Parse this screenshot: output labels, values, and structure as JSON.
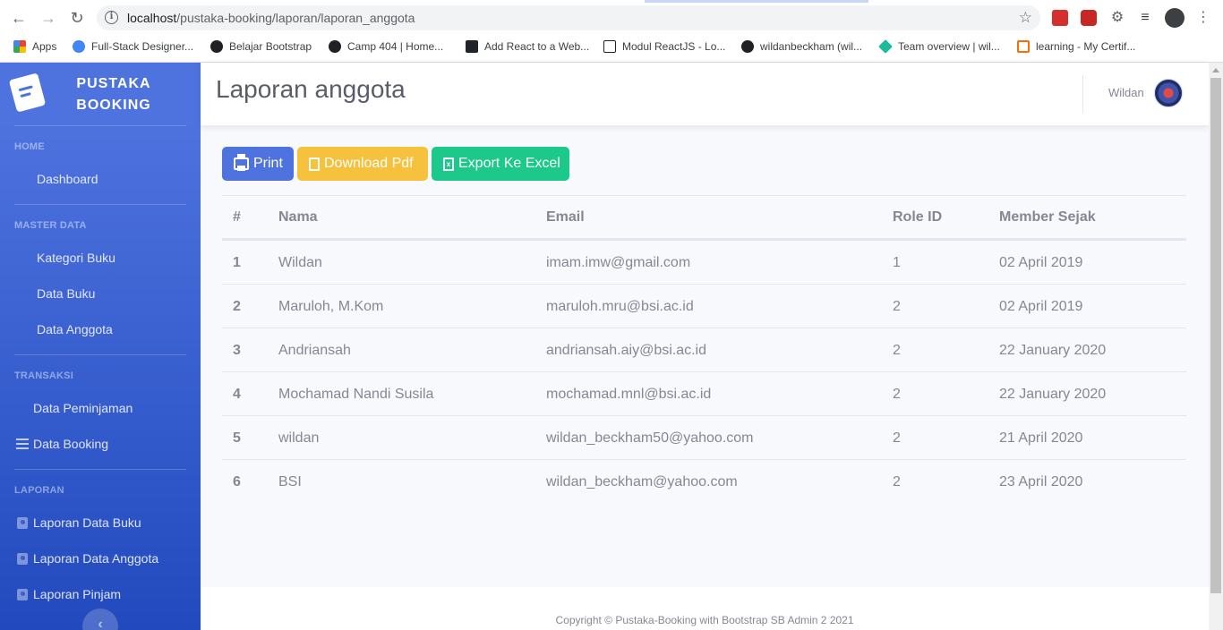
{
  "browser": {
    "url_host": "localhost",
    "url_path": "/pustaka-booking/laporan/laporan_anggota",
    "bookmarks": [
      {
        "label": "Apps",
        "color": "#ea4335"
      },
      {
        "label": "Full-Stack Designer...",
        "color": "#4285f4"
      },
      {
        "label": "Belajar Bootstrap",
        "color": "#202124"
      },
      {
        "label": "Camp 404 | Home...",
        "color": "#202124"
      },
      {
        "label": "Add React to a Web...",
        "color": "#61dafb"
      },
      {
        "label": "Modul ReactJS - Lo...",
        "color": "#202124"
      },
      {
        "label": "wildanbeckham (wil...",
        "color": "#202124"
      },
      {
        "label": "Team overview | wil...",
        "color": "#1abc9c"
      },
      {
        "label": "learning - My Certif...",
        "color": "#ff6d00"
      }
    ]
  },
  "sidebar": {
    "brand_line1": "PUSTAKA",
    "brand_line2": "BOOKING",
    "heading_home": "HOME",
    "dashboard": "Dashboard",
    "heading_master": "MASTER DATA",
    "kategori_buku": "Kategori Buku",
    "data_buku": "Data Buku",
    "data_anggota": "Data Anggota",
    "heading_transaksi": "TRANSAKSI",
    "data_peminjaman": "Data Peminjaman",
    "data_booking": "Data Booking",
    "heading_laporan": "LAPORAN",
    "laporan_buku": "Laporan Data Buku",
    "laporan_anggota": "Laporan Data Anggota",
    "laporan_pinjam": "Laporan Pinjam",
    "toggle": "‹"
  },
  "topbar": {
    "title": "Laporan anggota",
    "user_name": "Wildan"
  },
  "actions": {
    "print": "Print",
    "download_pdf": "Download Pdf",
    "export_excel": "Export Ke Excel"
  },
  "table": {
    "headers": [
      "#",
      "Nama",
      "Email",
      "Role ID",
      "Member Sejak"
    ],
    "rows": [
      [
        "1",
        "Wildan",
        "imam.imw@gmail.com",
        "1",
        "02 April 2019"
      ],
      [
        "2",
        "Maruloh, M.Kom",
        "maruloh.mru@bsi.ac.id",
        "2",
        "02 April 2019"
      ],
      [
        "3",
        "Andriansah",
        "andriansah.aiy@bsi.ac.id",
        "2",
        "22 January 2020"
      ],
      [
        "4",
        "Mochamad Nandi Susila",
        "mochamad.mnl@bsi.ac.id",
        "2",
        "22 January 2020"
      ],
      [
        "5",
        "wildan",
        "wildan_beckham50@yahoo.com",
        "2",
        "21 April 2020"
      ],
      [
        "6",
        "BSI",
        "wildan_beckham@yahoo.com",
        "2",
        "23 April 2020"
      ]
    ]
  },
  "footer": {
    "copyright": "Copyright © Pustaka-Booking with Bootstrap SB Admin 2 2021"
  },
  "colors": {
    "primary": "#4e73df",
    "warning": "#f6c23e",
    "success": "#1cc88a",
    "text_muted": "#858796"
  }
}
